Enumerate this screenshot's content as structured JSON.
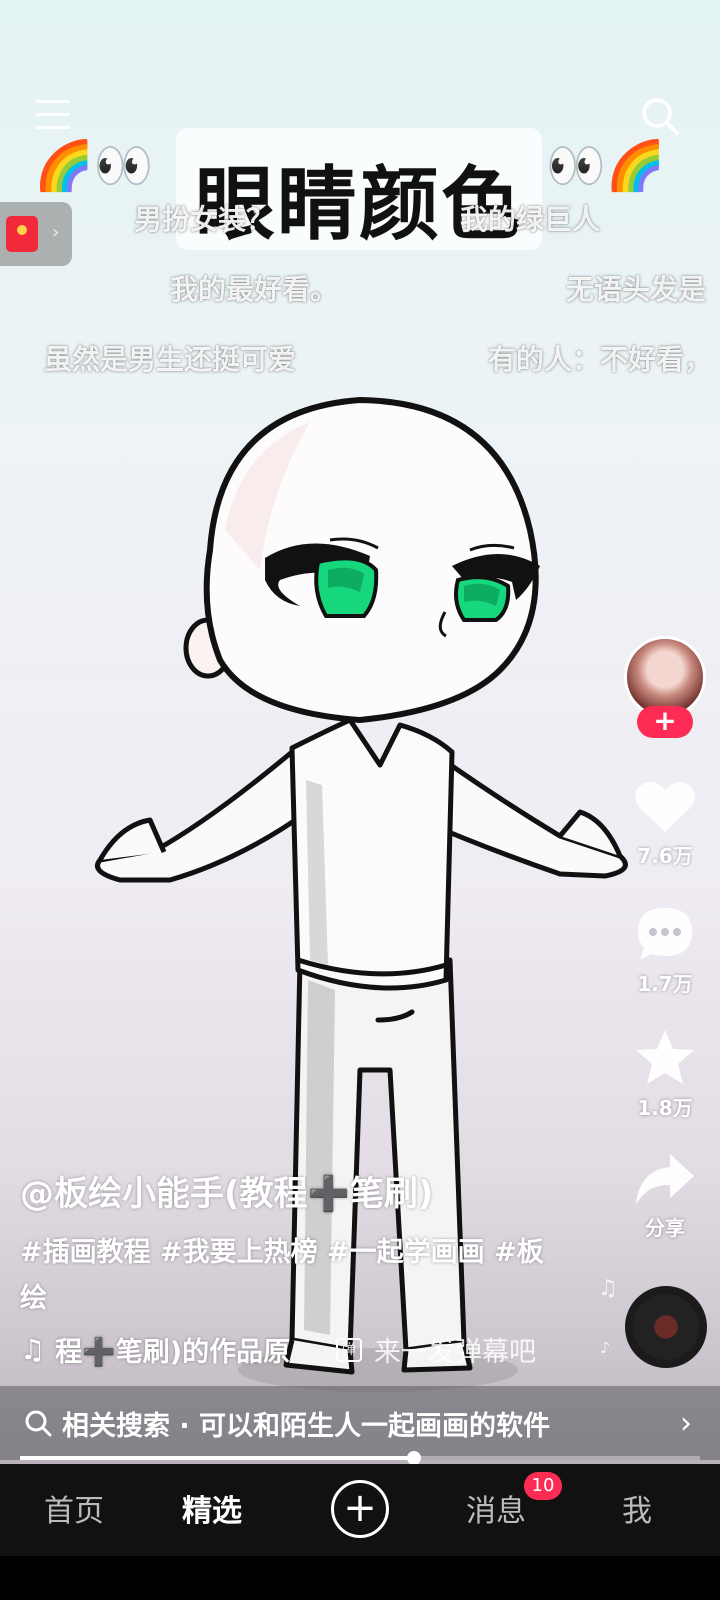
{
  "overlay_title": "眼睛颜色",
  "deco_left": "🌈👀",
  "deco_right": "👀🌈",
  "danmaku": [
    "男扮女装？",
    "我的绿巨人",
    "我的最好看。",
    "无语头发是",
    "虽然是男生还挺可爱",
    "有的人：不好看，"
  ],
  "actions": {
    "follow": "+",
    "like_count": "7.6万",
    "comment_count": "1.7万",
    "favorite_count": "1.8万",
    "share_label": "分享"
  },
  "post": {
    "author": "@板绘小能手(教程➕笔刷)",
    "description": "#插画教程 #我要上热榜 #一起学画画 #板绘",
    "music": "程➕笔刷)的作品原",
    "danmu_icon": "弹",
    "danmu_placeholder": "来一发弹幕吧"
  },
  "related_search": {
    "text": "相关搜索 · 可以和陌生人一起画画的软件"
  },
  "progress": {
    "fraction": 0.58
  },
  "tabs": {
    "home": "首页",
    "featured": "精选",
    "plus": "+",
    "messages": "消息",
    "messages_badge": "10",
    "me": "我"
  },
  "colors": {
    "accent": "#fe2c55",
    "eye": "#17d77c"
  }
}
